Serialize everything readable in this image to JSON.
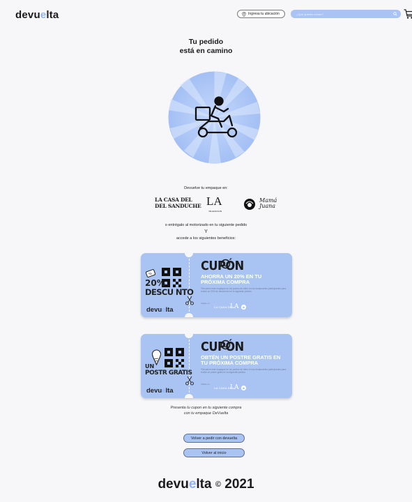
{
  "header": {
    "logo": {
      "prefix": "devu",
      "accent": "e",
      "suffix": "lta"
    },
    "location_button": "Ingresa tu ubicación",
    "search_placeholder": "¿Qué quieres comer?",
    "icons": [
      "location-pin-icon",
      "search-icon",
      "cart-icon"
    ]
  },
  "title": {
    "line1": "Tu pedido",
    "line2": "está en camino"
  },
  "return_section": {
    "label": "Devuelve tu empaque en:",
    "brands": [
      {
        "name_line1": "LA CASA DEL",
        "name_line2": "DEL SANDUCHE"
      },
      {
        "name": "LA",
        "sub": "TRADICION"
      },
      {
        "name_line1": "Mamá",
        "name_line2": "Juana"
      }
    ],
    "line1": "o entrégalo al motorizado en tu siguiente pedido",
    "line2": "Y",
    "line3": "accede a los siguientes beneficios:"
  },
  "coupons": [
    {
      "left_top": "20%",
      "left_bottom": "DESCU NTO",
      "brand": {
        "prefix": "devu",
        "accent": "e",
        "suffix": "lta"
      },
      "heading": "CUPÓN",
      "subtitle": "AHORRA UN 20% EN TU PRÓXIMA COMPRA",
      "fine_print": "*Devuelve este empaque en los puntos de retiro en los restaurantes participantes para recibir un 20% de descuento en tu siguiente pedido.",
      "valid_label": "Válido en:"
    },
    {
      "left_top": "UN",
      "left_bottom": "POSTR GRATIS",
      "brand": {
        "prefix": "devu",
        "accent": "e",
        "suffix": "lta"
      },
      "heading": "CUPÓN",
      "subtitle": "OBTÉN UN POSTRE GRATIS EN TU PRÓXIMA COMPRA",
      "fine_print": "*Devuelve este empaque en los puntos de retiro en los restaurantes participantes para recibir un postre gratis en tu siguiente pedido.",
      "valid_label": "Válido en:"
    }
  ],
  "present_text": {
    "line1": "Presenta tu cupon en tu siguiente compra",
    "line2": "con tu empaque DeVuelta"
  },
  "buttons": {
    "reorder": "Volver a pedir con devuelta",
    "home": "Volver al inicio"
  },
  "footer": {
    "logo": {
      "prefix": "devu",
      "accent": "e",
      "suffix": "lta"
    },
    "copyright": "©",
    "year": "2021"
  },
  "colors": {
    "accent": "#a9c4f3",
    "accent_dark": "#8fb4f5",
    "background": "#f7f7f9"
  }
}
